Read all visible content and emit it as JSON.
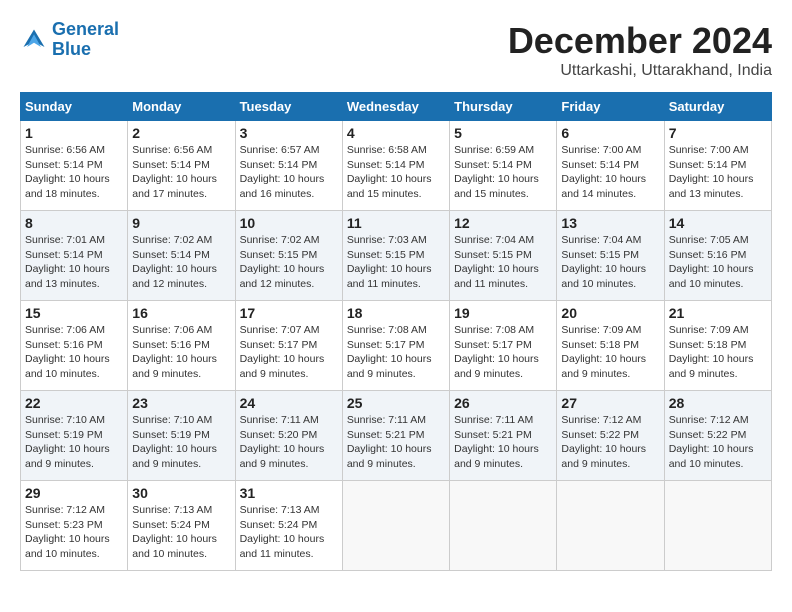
{
  "logo": {
    "line1": "General",
    "line2": "Blue"
  },
  "title": {
    "month": "December 2024",
    "location": "Uttarkashi, Uttarakhand, India"
  },
  "headers": [
    "Sunday",
    "Monday",
    "Tuesday",
    "Wednesday",
    "Thursday",
    "Friday",
    "Saturday"
  ],
  "weeks": [
    [
      {
        "day": "1",
        "info": "Sunrise: 6:56 AM\nSunset: 5:14 PM\nDaylight: 10 hours\nand 18 minutes."
      },
      {
        "day": "2",
        "info": "Sunrise: 6:56 AM\nSunset: 5:14 PM\nDaylight: 10 hours\nand 17 minutes."
      },
      {
        "day": "3",
        "info": "Sunrise: 6:57 AM\nSunset: 5:14 PM\nDaylight: 10 hours\nand 16 minutes."
      },
      {
        "day": "4",
        "info": "Sunrise: 6:58 AM\nSunset: 5:14 PM\nDaylight: 10 hours\nand 15 minutes."
      },
      {
        "day": "5",
        "info": "Sunrise: 6:59 AM\nSunset: 5:14 PM\nDaylight: 10 hours\nand 15 minutes."
      },
      {
        "day": "6",
        "info": "Sunrise: 7:00 AM\nSunset: 5:14 PM\nDaylight: 10 hours\nand 14 minutes."
      },
      {
        "day": "7",
        "info": "Sunrise: 7:00 AM\nSunset: 5:14 PM\nDaylight: 10 hours\nand 13 minutes."
      }
    ],
    [
      {
        "day": "8",
        "info": "Sunrise: 7:01 AM\nSunset: 5:14 PM\nDaylight: 10 hours\nand 13 minutes."
      },
      {
        "day": "9",
        "info": "Sunrise: 7:02 AM\nSunset: 5:14 PM\nDaylight: 10 hours\nand 12 minutes."
      },
      {
        "day": "10",
        "info": "Sunrise: 7:02 AM\nSunset: 5:15 PM\nDaylight: 10 hours\nand 12 minutes."
      },
      {
        "day": "11",
        "info": "Sunrise: 7:03 AM\nSunset: 5:15 PM\nDaylight: 10 hours\nand 11 minutes."
      },
      {
        "day": "12",
        "info": "Sunrise: 7:04 AM\nSunset: 5:15 PM\nDaylight: 10 hours\nand 11 minutes."
      },
      {
        "day": "13",
        "info": "Sunrise: 7:04 AM\nSunset: 5:15 PM\nDaylight: 10 hours\nand 10 minutes."
      },
      {
        "day": "14",
        "info": "Sunrise: 7:05 AM\nSunset: 5:16 PM\nDaylight: 10 hours\nand 10 minutes."
      }
    ],
    [
      {
        "day": "15",
        "info": "Sunrise: 7:06 AM\nSunset: 5:16 PM\nDaylight: 10 hours\nand 10 minutes."
      },
      {
        "day": "16",
        "info": "Sunrise: 7:06 AM\nSunset: 5:16 PM\nDaylight: 10 hours\nand 9 minutes."
      },
      {
        "day": "17",
        "info": "Sunrise: 7:07 AM\nSunset: 5:17 PM\nDaylight: 10 hours\nand 9 minutes."
      },
      {
        "day": "18",
        "info": "Sunrise: 7:08 AM\nSunset: 5:17 PM\nDaylight: 10 hours\nand 9 minutes."
      },
      {
        "day": "19",
        "info": "Sunrise: 7:08 AM\nSunset: 5:17 PM\nDaylight: 10 hours\nand 9 minutes."
      },
      {
        "day": "20",
        "info": "Sunrise: 7:09 AM\nSunset: 5:18 PM\nDaylight: 10 hours\nand 9 minutes."
      },
      {
        "day": "21",
        "info": "Sunrise: 7:09 AM\nSunset: 5:18 PM\nDaylight: 10 hours\nand 9 minutes."
      }
    ],
    [
      {
        "day": "22",
        "info": "Sunrise: 7:10 AM\nSunset: 5:19 PM\nDaylight: 10 hours\nand 9 minutes."
      },
      {
        "day": "23",
        "info": "Sunrise: 7:10 AM\nSunset: 5:19 PM\nDaylight: 10 hours\nand 9 minutes."
      },
      {
        "day": "24",
        "info": "Sunrise: 7:11 AM\nSunset: 5:20 PM\nDaylight: 10 hours\nand 9 minutes."
      },
      {
        "day": "25",
        "info": "Sunrise: 7:11 AM\nSunset: 5:21 PM\nDaylight: 10 hours\nand 9 minutes."
      },
      {
        "day": "26",
        "info": "Sunrise: 7:11 AM\nSunset: 5:21 PM\nDaylight: 10 hours\nand 9 minutes."
      },
      {
        "day": "27",
        "info": "Sunrise: 7:12 AM\nSunset: 5:22 PM\nDaylight: 10 hours\nand 9 minutes."
      },
      {
        "day": "28",
        "info": "Sunrise: 7:12 AM\nSunset: 5:22 PM\nDaylight: 10 hours\nand 10 minutes."
      }
    ],
    [
      {
        "day": "29",
        "info": "Sunrise: 7:12 AM\nSunset: 5:23 PM\nDaylight: 10 hours\nand 10 minutes."
      },
      {
        "day": "30",
        "info": "Sunrise: 7:13 AM\nSunset: 5:24 PM\nDaylight: 10 hours\nand 10 minutes."
      },
      {
        "day": "31",
        "info": "Sunrise: 7:13 AM\nSunset: 5:24 PM\nDaylight: 10 hours\nand 11 minutes."
      },
      {
        "day": "",
        "info": ""
      },
      {
        "day": "",
        "info": ""
      },
      {
        "day": "",
        "info": ""
      },
      {
        "day": "",
        "info": ""
      }
    ]
  ]
}
